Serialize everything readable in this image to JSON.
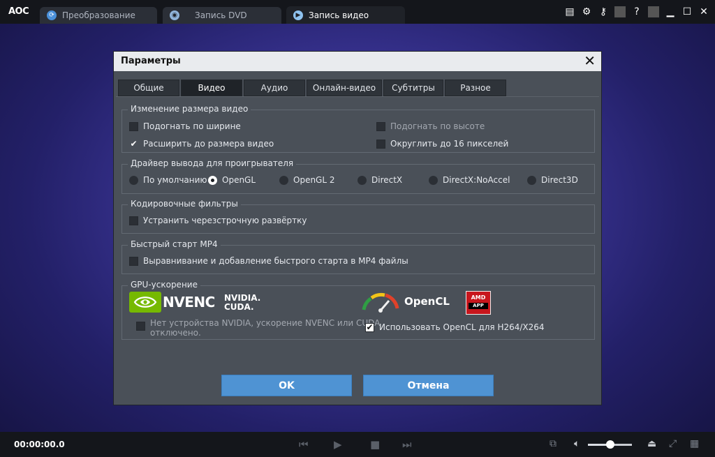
{
  "app": {
    "logo": "AOC",
    "tabs": [
      {
        "label": "Преобразование",
        "icon": "convert-icon",
        "active": false
      },
      {
        "label": "Запись DVD",
        "icon": "dvd-icon",
        "active": false
      },
      {
        "label": "Запись видео",
        "icon": "play-icon",
        "active": true
      }
    ],
    "toolbar_icons": [
      "list-icon",
      "gear-icon",
      "key-icon",
      "help-icon",
      "minimize-icon",
      "maximize-icon",
      "close-icon"
    ],
    "toolbar_glyphs": {
      "help": "?"
    }
  },
  "dialog": {
    "title": "Параметры",
    "tabs": [
      "Общие",
      "Видео",
      "Аудио",
      "Онлайн-видео",
      "Субтитры",
      "Разное"
    ],
    "active_tab": "Видео",
    "resize": {
      "label": "Изменение размера видео",
      "fit_width": {
        "label": "Подогнать по ширине",
        "checked": false
      },
      "fit_height": {
        "label": "Подогнать по высоте",
        "checked": false,
        "disabled": true
      },
      "expand": {
        "label": "Расширить до размера видео",
        "checked": true
      },
      "round16": {
        "label": "Округлить до 16 пикселей",
        "checked": false
      }
    },
    "driver": {
      "label": "Драйвер вывода для проигрывателя",
      "options": [
        "По умолчанию",
        "OpenGL",
        "OpenGL 2",
        "DirectX",
        "DirectX:NoAccel",
        "Direct3D"
      ],
      "selected": "OpenGL"
    },
    "codec": {
      "label": "Кодировочные фильтры",
      "deinterlace": {
        "label": "Устранить черезстрочную развёртку",
        "checked": false
      }
    },
    "mp4": {
      "label": "Быстрый старт MP4",
      "faststart": {
        "label": "Выравнивание и добавление быстрого старта в MP4 файлы",
        "checked": false
      }
    },
    "gpu": {
      "label": "GPU-ускорение",
      "nvenc_logo": "NVENC",
      "cuda_line1": "NVIDIA.",
      "cuda_line2": "CUDA.",
      "nvidia_msg_line1": "Нет устройства NVIDIA, ускорение NVENC или CUDA",
      "nvidia_msg_line2": "отключено.",
      "opencl_logo": "OpenCL",
      "amd_line1": "AMD",
      "amd_line2": "APP",
      "opencl_use": {
        "label": "Использовать OpenCL для H264/X264",
        "checked": true
      }
    },
    "ok_label": "OK",
    "cancel_label": "Отмена"
  },
  "player": {
    "time": "00:00:00.0",
    "volume": 0.5
  },
  "colors": {
    "accent_button": "#4f93d3",
    "nvidia_green": "#76b900",
    "amd_red": "#c8161d"
  }
}
